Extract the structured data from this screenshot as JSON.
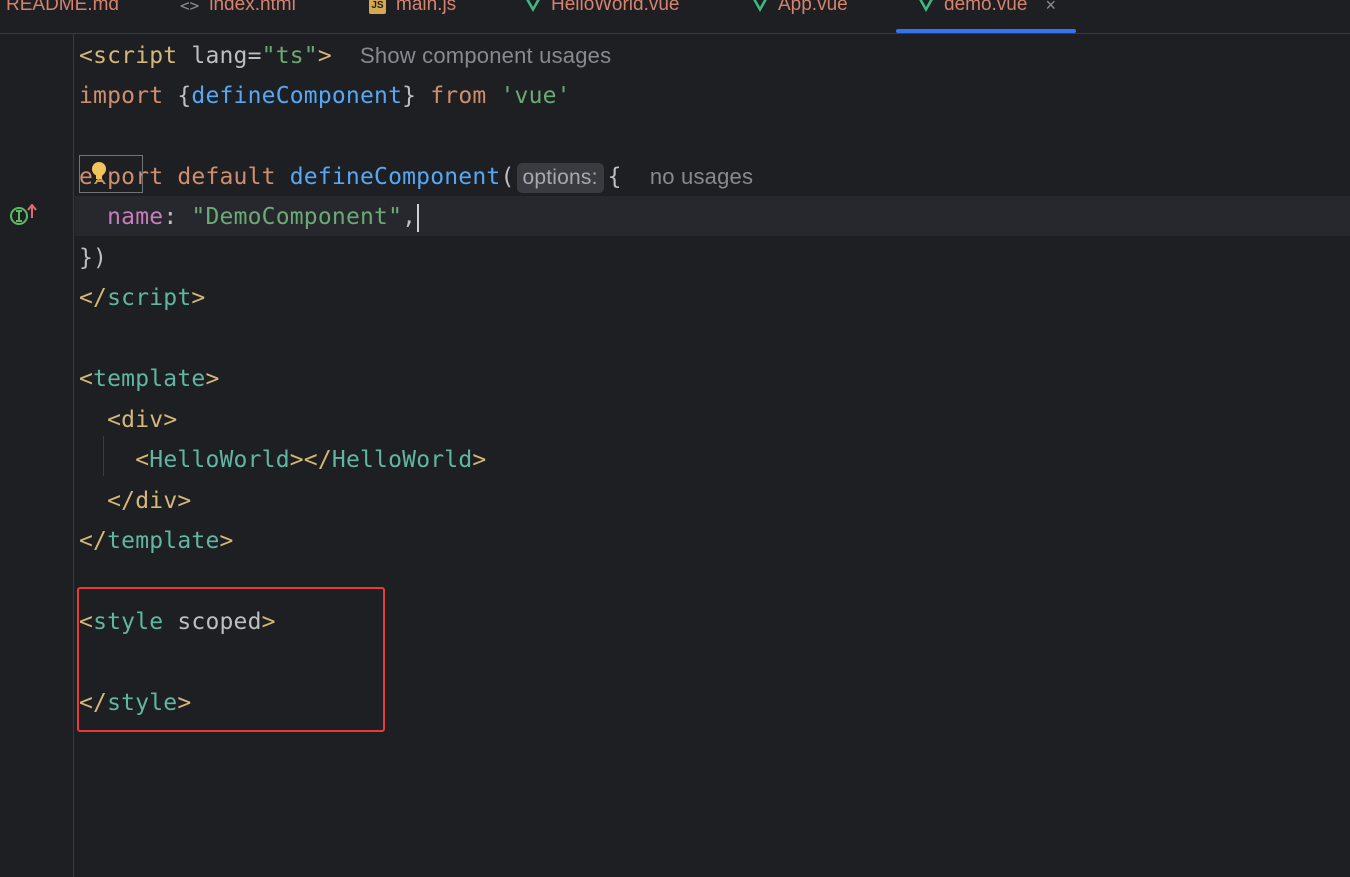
{
  "tabs": [
    {
      "label": "README.md",
      "icon": "markdown-icon",
      "active": false
    },
    {
      "label": "index.html",
      "icon": "html-file-icon",
      "icon_glyph": "<>",
      "active": false
    },
    {
      "label": "main.js",
      "icon": "js-file-icon",
      "icon_glyph": "JS",
      "active": false
    },
    {
      "label": "HelloWorld.vue",
      "icon": "vue-file-icon",
      "active": false
    },
    {
      "label": "App.vue",
      "icon": "vue-file-icon",
      "active": false
    },
    {
      "label": "demo.vue",
      "icon": "vue-file-icon",
      "active": true,
      "close": "×"
    }
  ],
  "editor": {
    "line1": {
      "open": "<",
      "tag": "script",
      "attr": " lang=",
      "val": "\"ts\"",
      "close": ">",
      "hint": "Show component usages"
    },
    "line2": {
      "import": "import",
      "brace_open": " {",
      "name": "defineComponent",
      "brace_close": "} ",
      "from": "from",
      "module": " 'vue'"
    },
    "line4": {
      "export": "export",
      "default": " default",
      "call": " defineComponent",
      "paren": "(",
      "inlay": "options:",
      "brace": "{",
      "hint": "no usages"
    },
    "line5": {
      "prop": "name",
      "colon": ": ",
      "value": "\"DemoComponent\"",
      "comma": ","
    },
    "line6": {
      "text": "})"
    },
    "line7": {
      "open": "</",
      "tag": "script",
      "close": ">"
    },
    "line9": {
      "open": "<",
      "tag": "template",
      "close": ">"
    },
    "line10": {
      "open": "<",
      "tag": "div",
      "close": ">"
    },
    "line11": {
      "open": "<",
      "tag": "HelloWorld",
      "mid": "></",
      "tag2": "HelloWorld",
      "close": ">"
    },
    "line12": {
      "open": "</",
      "tag": "div",
      "close": ">"
    },
    "line13": {
      "open": "</",
      "tag": "template",
      "close": ">"
    },
    "line15": {
      "open": "<",
      "tag": "style",
      "attr": " scoped",
      "close": ">"
    },
    "line17": {
      "open": "</",
      "tag": "style",
      "close": ">"
    }
  },
  "colors": {
    "background": "#1e1f22",
    "tab_text": "#d5836f",
    "active_tab_underline": "#3574f0",
    "highlight_box": "#e83a3a"
  }
}
